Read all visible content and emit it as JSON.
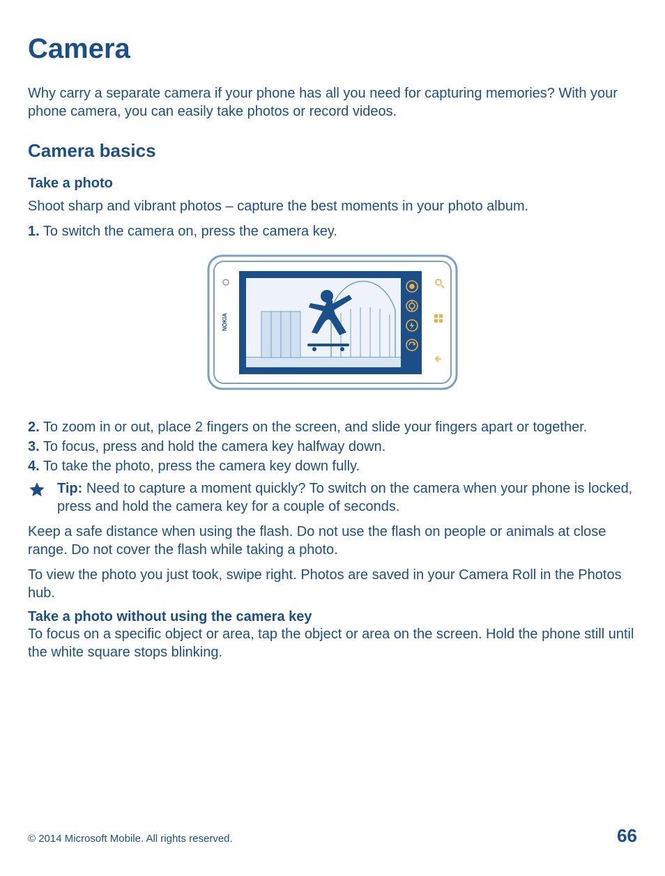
{
  "title": "Camera",
  "intro": "Why carry a separate camera if your phone has all you need for capturing memories? With your phone camera, you can easily take photos or record videos.",
  "section_heading": "Camera basics",
  "sub1_heading": "Take a photo",
  "sub1_intro": "Shoot sharp and vibrant photos – capture the best moments in your photo album.",
  "steps": {
    "s1_num": "1.",
    "s1_text": " To switch the camera on, press the camera key.",
    "s2_num": "2.",
    "s2_text": " To zoom in or out, place 2 fingers on the screen, and slide your fingers apart or together.",
    "s3_num": "3.",
    "s3_text": " To focus, press and hold the camera key halfway down.",
    "s4_num": "4.",
    "s4_text": " To take the photo, press the camera key down fully."
  },
  "tip": {
    "label": "Tip:",
    "text": " Need to capture a moment quickly? To switch on the camera when your phone is locked, press and hold the camera key for a couple of seconds."
  },
  "safety": "Keep a safe distance when using the flash. Do not use the flash on people or animals at close range. Do not cover the flash while taking a photo.",
  "view_photo": "To view the photo you just took, swipe right. Photos are saved in your Camera Roll in the Photos hub.",
  "sub2_heading": "Take a photo without using the camera key",
  "sub2_body": "To focus on a specific object or area, tap the object or area on the screen. Hold the phone still until the white square stops blinking.",
  "footer": {
    "copyright": "© 2014 Microsoft Mobile. All rights reserved.",
    "page_number": "66"
  },
  "figure": {
    "brand": "NOKIA"
  }
}
